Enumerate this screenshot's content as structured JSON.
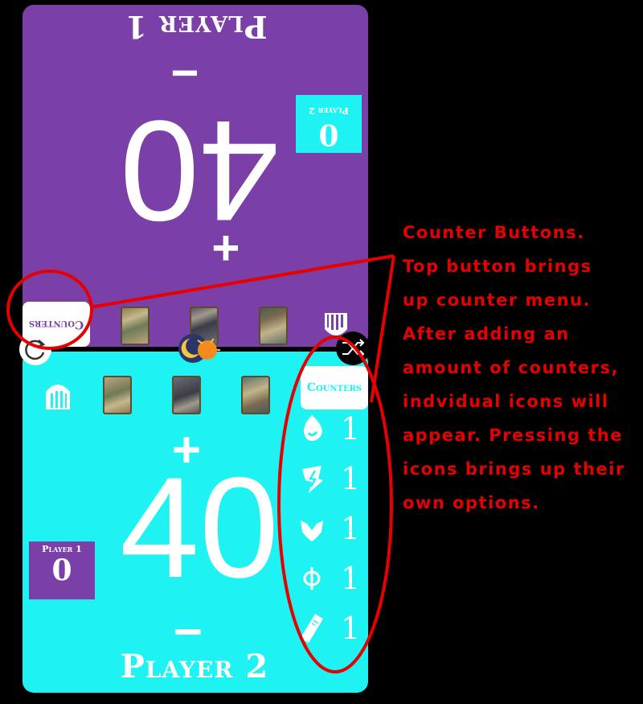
{
  "player1": {
    "name": "Player 1",
    "life": "40",
    "plus": "+",
    "minus": "−",
    "color": "#7b3fa8",
    "commander_damage": {
      "label": "Player 2",
      "value": "0",
      "color": "#1ef2f2"
    },
    "counters_button": "Counters",
    "cards": [
      "card-art",
      "card-art",
      "card-art"
    ],
    "icon": "castle-gate-icon"
  },
  "player2": {
    "name": "Player 2",
    "life": "40",
    "plus": "+",
    "minus": "−",
    "color": "#1ef2f2",
    "commander_damage": {
      "label": "Player 1",
      "value": "0",
      "color": "#7b3fa8"
    },
    "counters_button": "Counters",
    "counters": [
      {
        "icon": "poison-drop-icon",
        "value": "1"
      },
      {
        "icon": "energy-bolt-icon",
        "value": "1"
      },
      {
        "icon": "experience-wings-icon",
        "value": "1"
      },
      {
        "icon": "phi-icon",
        "value": "1"
      },
      {
        "icon": "ticket-icon",
        "value": "1"
      }
    ],
    "icon": "castle-gate-icon"
  },
  "center_controls": {
    "reset": "reset-icon",
    "day_night": "day-night-icon",
    "random": "shuffle-icon"
  },
  "annotation": {
    "color": "#e60000",
    "lines": [
      "Counter Buttons.",
      "Top button brings",
      "up counter menu.",
      "After adding an",
      "amount of counters,",
      "indvidual icons will",
      "appear. Pressing the",
      "icons brings up their",
      "own options."
    ]
  }
}
